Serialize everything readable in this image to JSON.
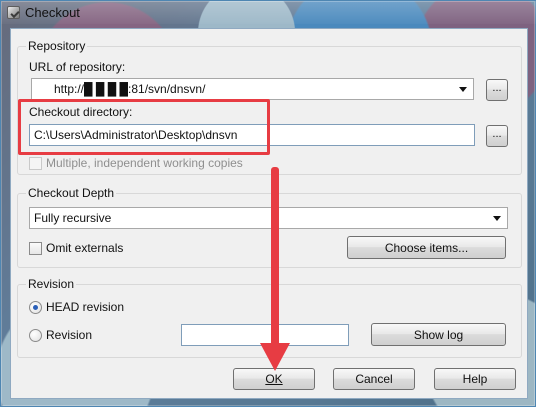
{
  "window": {
    "title": "Checkout"
  },
  "repository": {
    "legend": "Repository",
    "url_label": "URL of repository:",
    "url_value": "http://█ █ █ █:81/svn/dnsvn/",
    "browse_button": "...",
    "checkout_directory_label": "Checkout directory:",
    "checkout_directory_value": "C:\\Users\\Administrator\\Desktop\\dnsvn",
    "checkout_directory_browse_button": "...",
    "multiple_copies_label": "Multiple, independent working copies"
  },
  "depth": {
    "legend": "Checkout Depth",
    "selected": "Fully recursive",
    "omit_externals_label": "Omit externals",
    "choose_items_button": "Choose items..."
  },
  "revision": {
    "legend": "Revision",
    "head_label": "HEAD revision",
    "revision_label": "Revision",
    "revision_value": "",
    "show_log_button": "Show log"
  },
  "footer": {
    "ok_button": "OK",
    "cancel_button": "Cancel",
    "help_button": "Help"
  },
  "annotations": {
    "highlight_color": "#e73c43"
  }
}
